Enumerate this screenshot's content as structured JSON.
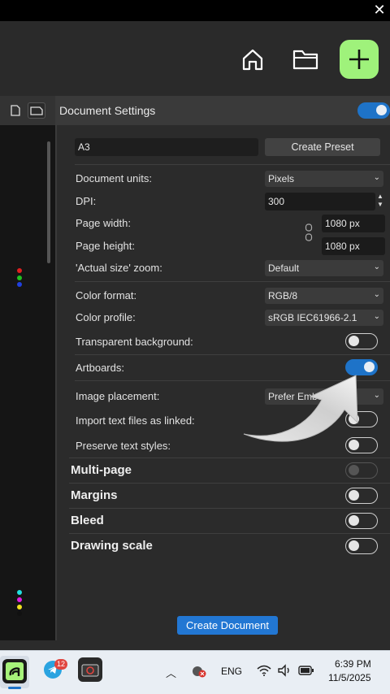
{
  "window": {
    "close_glyph": "✕"
  },
  "header": {
    "home_icon": "home-icon",
    "folder_icon": "folder-icon",
    "plus_icon": "plus-icon",
    "accent": "#9ff27b"
  },
  "panel": {
    "title": "Document Settings",
    "title_toggle_on": true,
    "preset_name": "A3",
    "create_preset_label": "Create Preset",
    "rows": {
      "document_units": {
        "label": "Document units:",
        "value": "Pixels"
      },
      "dpi": {
        "label": "DPI:",
        "value": "300"
      },
      "page_width": {
        "label": "Page width:",
        "value": "1080 px"
      },
      "page_height": {
        "label": "Page height:",
        "value": "1080 px"
      },
      "actual_size_zoom": {
        "label": "'Actual size' zoom:",
        "value": "Default"
      },
      "color_format": {
        "label": "Color format:",
        "value": "RGB/8"
      },
      "color_profile": {
        "label": "Color profile:",
        "value": "sRGB IEC61966-2.1"
      },
      "transparent_background": {
        "label": "Transparent background:",
        "on": false
      },
      "artboards": {
        "label": "Artboards:",
        "on": true
      },
      "image_placement": {
        "label": "Image placement:",
        "value": "Prefer Embe"
      },
      "import_text_linked": {
        "label": "Import text files as linked:",
        "on": false
      },
      "preserve_text_styles": {
        "label": "Preserve text styles:",
        "on": false
      }
    },
    "sections": {
      "multi_page": {
        "label": "Multi-page",
        "on": false,
        "disabled": true
      },
      "margins": {
        "label": "Margins",
        "on": false
      },
      "bleed": {
        "label": "Bleed",
        "on": false
      },
      "drawing_scale": {
        "label": "Drawing scale",
        "on": false
      }
    },
    "create_document_label": "Create Document"
  },
  "taskbar": {
    "telegram_badge": "12",
    "language": "ENG",
    "time": "6:39 PM",
    "date": "11/5/2025"
  },
  "colors": {
    "accent_blue": "#1e73c8",
    "primary_button": "#2277d3"
  }
}
